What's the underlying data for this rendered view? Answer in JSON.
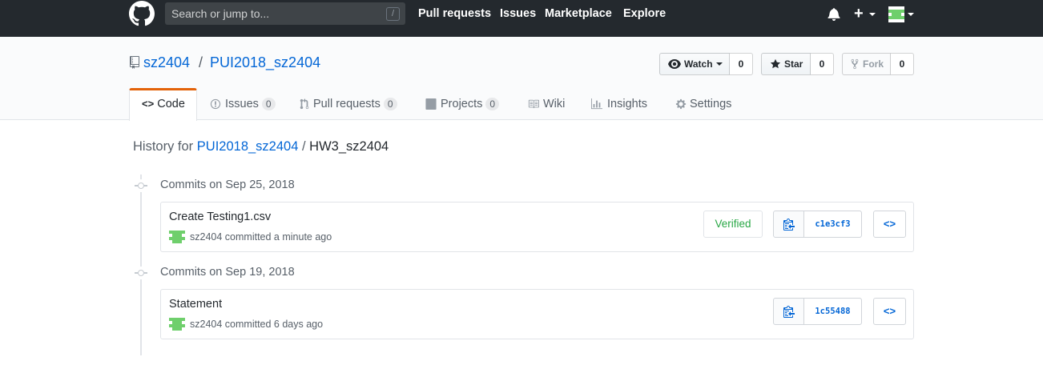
{
  "header": {
    "search_placeholder": "Search or jump to...",
    "search_shortcut": "/",
    "nav": [
      "Pull requests",
      "Issues",
      "Marketplace",
      "Explore"
    ],
    "plus": "+"
  },
  "repo": {
    "owner": "sz2404",
    "separator": "/",
    "name": "PUI2018_sz2404",
    "watch": {
      "label": "Watch",
      "count": "0"
    },
    "star": {
      "label": "Star",
      "count": "0"
    },
    "fork": {
      "label": "Fork",
      "count": "0"
    }
  },
  "tabs": [
    {
      "label": "Code",
      "counter": null,
      "selected": true
    },
    {
      "label": "Issues",
      "counter": "0"
    },
    {
      "label": "Pull requests",
      "counter": "0"
    },
    {
      "label": "Projects",
      "counter": "0"
    },
    {
      "label": "Wiki",
      "counter": null
    },
    {
      "label": "Insights",
      "counter": null
    },
    {
      "label": "Settings",
      "counter": null
    }
  ],
  "history": {
    "prefix": "History for",
    "repo_link": "PUI2018_sz2404",
    "separator": "/",
    "path": "HW3_sz2404"
  },
  "commit_groups": [
    {
      "date": "Commits on Sep 25, 2018",
      "commit": {
        "title": "Create Testing1.csv",
        "author": "sz2404",
        "meta": "committed a minute ago",
        "verified": "Verified",
        "sha": "c1e3cf3"
      }
    },
    {
      "date": "Commits on Sep 19, 2018",
      "commit": {
        "title": "Statement",
        "author": "sz2404",
        "meta": "committed 6 days ago",
        "sha": "1c55488"
      }
    }
  ],
  "colors": {
    "header_bg": "#24292e",
    "link": "#0366d6",
    "tab_accent": "#e36209",
    "verified": "#28a745",
    "avatar": "#6fcf6c"
  }
}
